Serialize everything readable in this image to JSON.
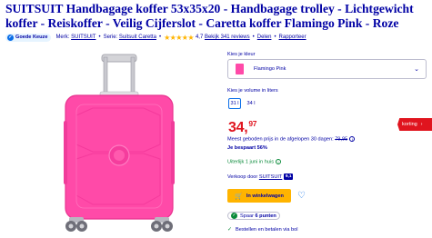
{
  "title": "SUITSUIT Handbagage koffer 53x35x20 - Handbagage trolley - Lichtgewicht koffer - Reiskoffer - Veilig Cijferslot - Caretta koffer Flamingo Pink - Roze",
  "meta": {
    "badge": "Goede Keuze",
    "brand_label": "Merk:",
    "brand": "SUITSUIT",
    "series_label": "Serie:",
    "series": "Suitsuit Caretta",
    "rating": "4,7",
    "reviews": "Bekijk 341 reviews",
    "share": "Delen",
    "report": "Rapporteer"
  },
  "color": {
    "label": "Kies je kleur",
    "selected": "Flamingo Pink",
    "swatch": "#ff4aa8"
  },
  "volume": {
    "label": "Kies je volume in liters",
    "options": [
      "31 l",
      "34 l"
    ],
    "selected_index": 0
  },
  "price": {
    "main": "34,",
    "cents": "97"
  },
  "discount": {
    "label": "korting"
  },
  "lowest": {
    "text": "Meest geboden prijs in de afgelopen 30 dagen: ",
    "value": "79,95"
  },
  "savings": "Je bespaart 56%",
  "delivery": "Uiterlijk 1 juni in huis",
  "seller": {
    "label": "Verkoop door",
    "name": "SUITSUIT",
    "badge": "9,1"
  },
  "cart": {
    "label": "In winkelwagen"
  },
  "points": {
    "prefix": "Spaar",
    "value": "6 punten"
  },
  "order": "Bestellen en betalen via bol",
  "colors": {
    "brand": "#0000a4",
    "price": "#e0141e",
    "cta": "#ffb400",
    "product": "#ff4aa8"
  }
}
